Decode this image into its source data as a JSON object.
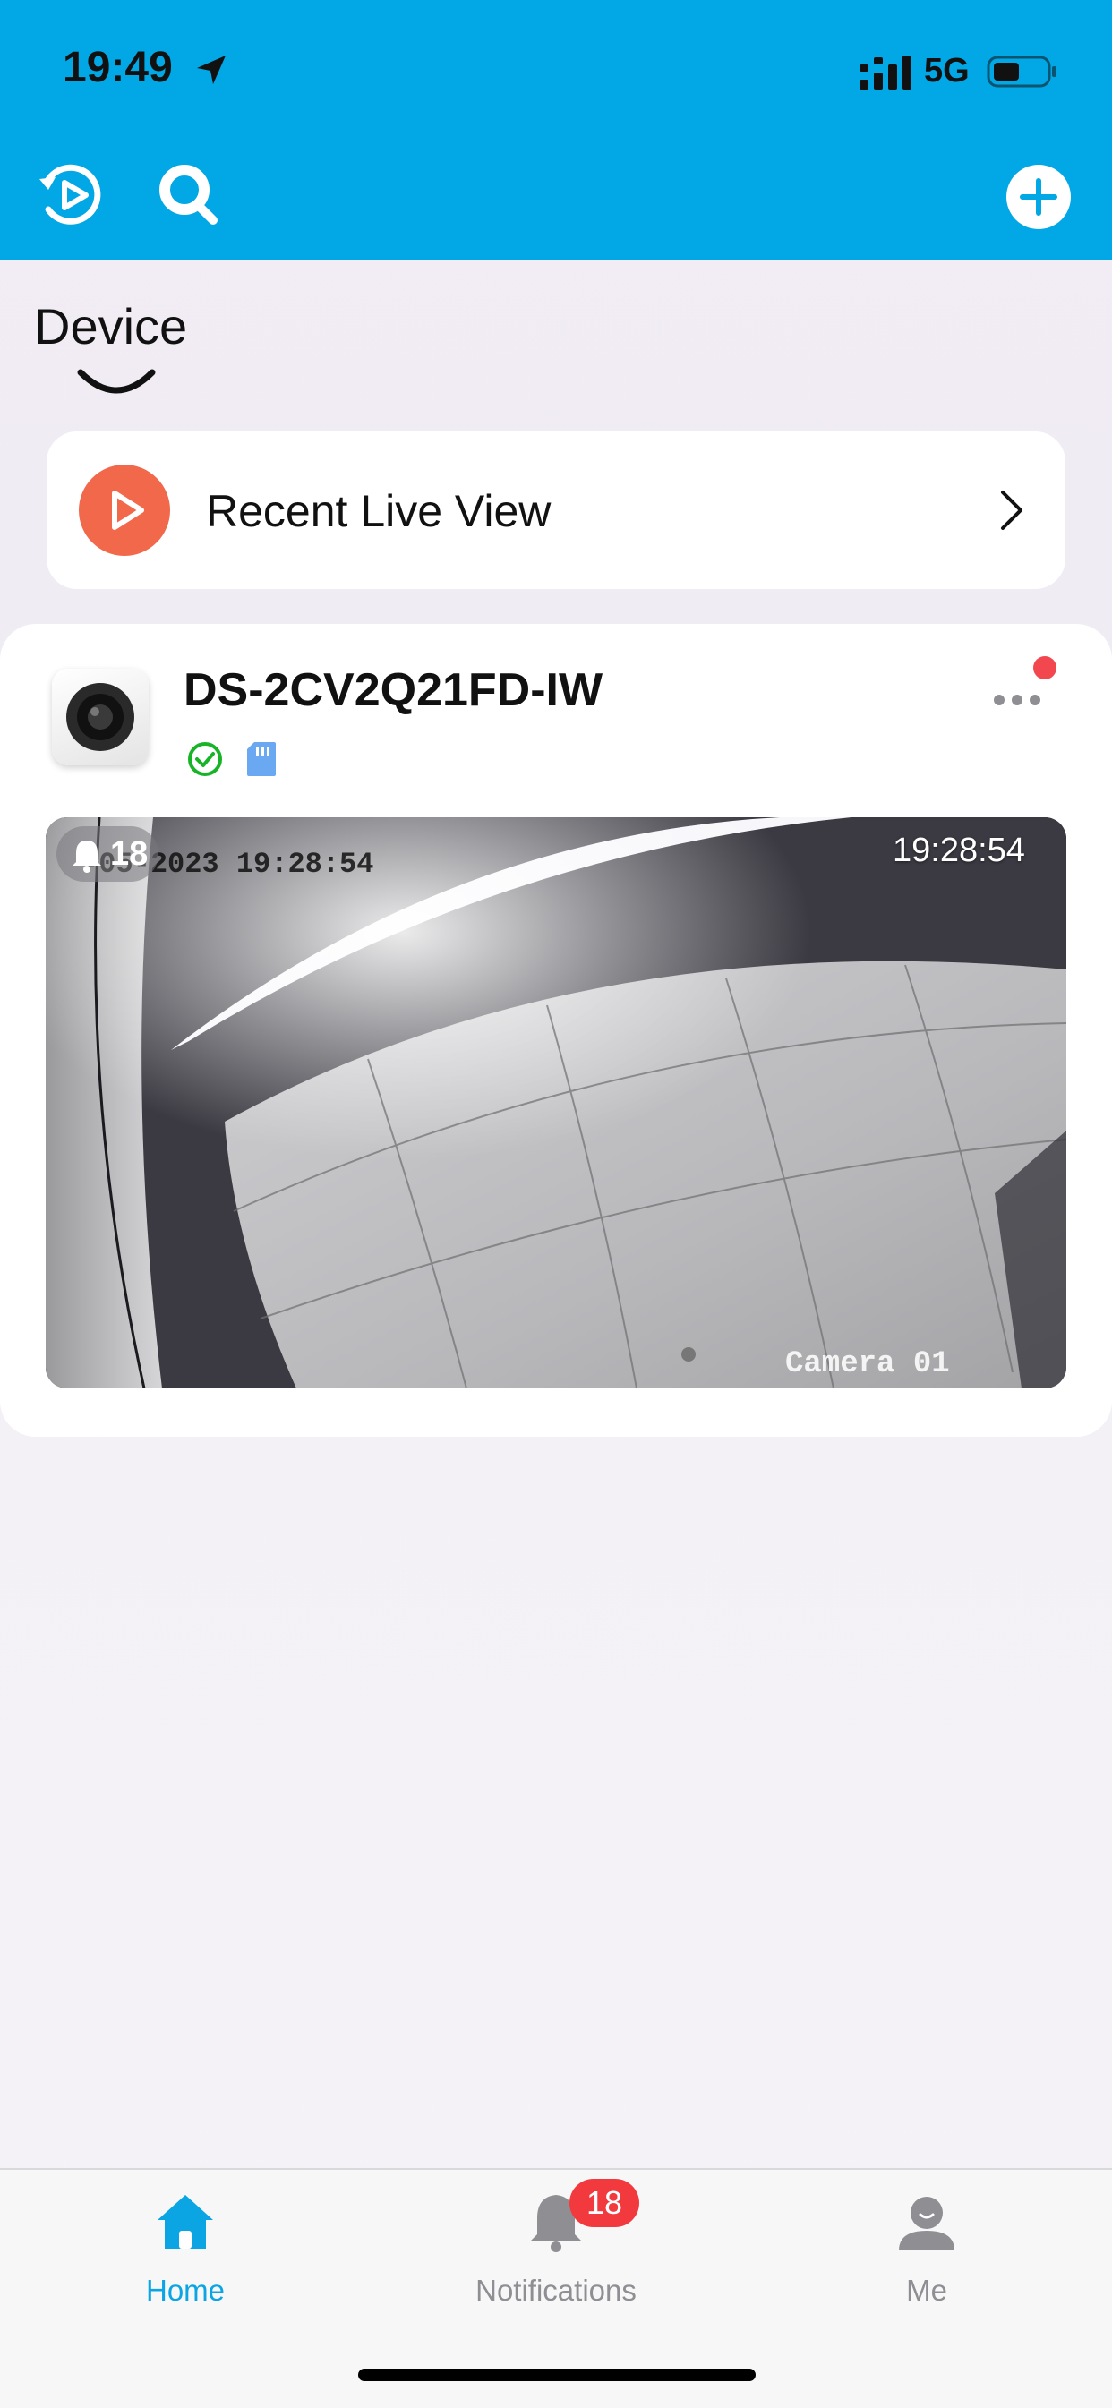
{
  "status_bar": {
    "time": "19:49",
    "network": "5G"
  },
  "toolbar": {
    "left_icons": [
      "playback-icon",
      "search-icon"
    ],
    "right_icons": [
      "add-icon"
    ]
  },
  "section_title": "Device",
  "recent_live_view": {
    "label": "Recent Live View"
  },
  "device": {
    "name": "DS-2CV2Q21FD-IW",
    "status_icons": [
      "online-check-icon",
      "sd-card-icon"
    ],
    "preview": {
      "alert_count": "18",
      "time": "19:28:54",
      "osd_date": "-05-2023 19:28:54",
      "osd_camera": "Camera 01"
    }
  },
  "tab_bar": {
    "tabs": [
      {
        "label": "Home",
        "icon": "home-icon",
        "active": true
      },
      {
        "label": "Notifications",
        "icon": "bell-icon",
        "badge": "18"
      },
      {
        "label": "Me",
        "icon": "person-icon"
      }
    ]
  },
  "colors": {
    "header_blue": "#02a7e5",
    "accent_orange": "#f2684a",
    "badge_red": "#f2393d",
    "active_tab": "#0ba5e3",
    "inactive_tab": "#8e8e93"
  }
}
